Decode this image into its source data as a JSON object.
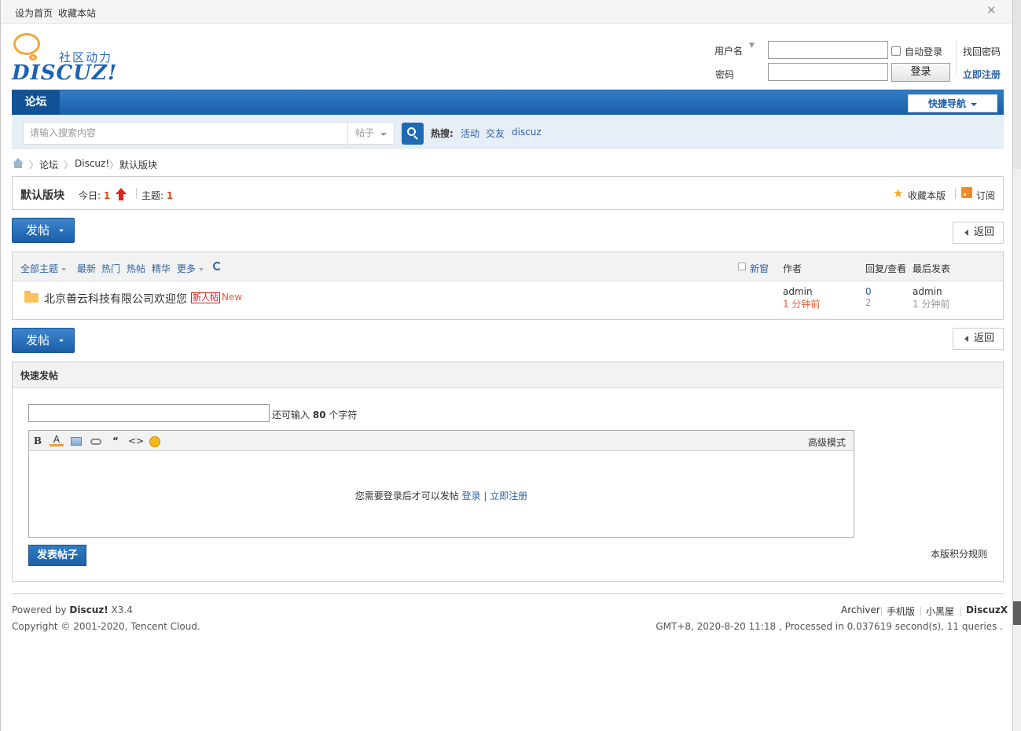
{
  "topbar": {
    "set_home": "设为首页",
    "bookmark": "收藏本站"
  },
  "logo": {
    "tagline": "社区动力",
    "word": "DISCUZ!"
  },
  "login": {
    "username_label": "用户名",
    "password_label": "密码",
    "auto_login": "自动登录",
    "login_button": "登录",
    "find_password": "找回密码",
    "register": "立即注册"
  },
  "nav": {
    "forum": "论坛",
    "quick_nav": "快捷导航"
  },
  "search": {
    "placeholder": "请输入搜索内容",
    "type": "帖子",
    "hot_label": "热搜:",
    "hot_terms": [
      "活动",
      "交友",
      "discuz"
    ]
  },
  "breadcrumb": [
    "论坛",
    "Discuz!",
    "默认版块"
  ],
  "forum": {
    "title": "默认版块",
    "today_label": "今日:",
    "today_value": "1",
    "threads_label": "主题:",
    "threads_value": "1",
    "favorite": "收藏本版",
    "subscribe": "订阅"
  },
  "buttons": {
    "post": "发帖",
    "back": "返回"
  },
  "threadlist": {
    "filters": [
      "全部主题",
      "最新",
      "热门",
      "热帖",
      "精华",
      "更多"
    ],
    "new_window": "新窗",
    "col_author": "作者",
    "col_replies": "回复/查看",
    "col_last": "最后发表",
    "rows": [
      {
        "title": "北京善云科技有限公司欢迎您",
        "tag": "新人帖",
        "badge": "New",
        "author": "admin",
        "author_time": "1 分钟前",
        "replies": "0",
        "views": "2",
        "last_author": "admin",
        "last_time": "1 分钟前"
      }
    ]
  },
  "fastpost": {
    "header": "快速发帖",
    "remain_prefix": "还可输入",
    "remain_count": "80",
    "remain_suffix": "个字符",
    "toolbar": [
      "B",
      "A"
    ],
    "advanced_mode": "高级模式",
    "login_prompt": "您需要登录后才可以发帖",
    "login_link": "登录",
    "sep": "|",
    "register_link": "立即注册",
    "submit": "发表帖子",
    "rules": "本版积分规则"
  },
  "footer": {
    "powered_prefix": "Powered by",
    "powered_brand": "Discuz!",
    "powered_version": "X3.4",
    "copyright": "Copyright © 2001-2020, Tencent Cloud.",
    "links": [
      "Archiver",
      "手机版",
      "小黑屋",
      "DiscuzX"
    ],
    "stats": "GMT+8, 2020-8-20 11:18 , Processed in 0.037619 second(s), 11 queries ."
  }
}
